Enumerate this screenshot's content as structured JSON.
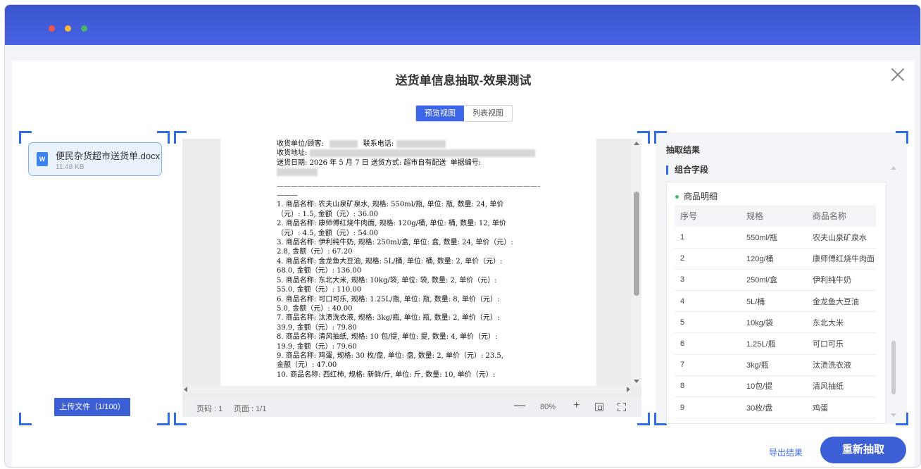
{
  "window": {
    "title": ""
  },
  "modal": {
    "title": "送货单信息抽取-效果测试"
  },
  "view_tabs": {
    "preview": "预览视图",
    "list": "列表视图",
    "active": "preview"
  },
  "file": {
    "name": "便民杂货超市送货单.docx",
    "size": "11.48 KB",
    "icon_letter": "W"
  },
  "upload_button": "上传文件（1/100）",
  "document": {
    "header_lines": [
      {
        "prefix": "收货单位/顾客:",
        "suffix": "联系电话:"
      },
      {
        "prefix": "收货地址:",
        "suffix": ""
      },
      {
        "prefix": "送货日期: 2026 年 5 月 7 日 送货方式: 超市自有配送  单据编号:",
        "suffix": ""
      }
    ],
    "divider": "————————————————————————————————————————",
    "divider_tail": "———",
    "lines": [
      "1. 商品名称: 农夫山泉矿泉水, 规格: 550ml/瓶, 单位: 瓶, 数量: 24, 单价",
      "（元）: 1.5, 金额（元）: 36.00",
      "2. 商品名称: 康师傅红烧牛肉面, 规格: 120g/桶, 单位: 桶, 数量: 12, 单价",
      "（元）: 4.5, 金额（元）: 54.00",
      "3. 商品名称: 伊利纯牛奶, 规格: 250ml/盒, 单位: 盒, 数量: 24, 单价（元）:",
      "2.8, 金额（元）: 67.20",
      "4. 商品名称: 金龙鱼大豆油, 规格: 5L/桶, 单位: 桶, 数量: 2, 单价（元）:",
      "68.0, 金额（元）: 136.00",
      "5. 商品名称: 东北大米, 规格: 10kg/袋, 单位: 袋, 数量: 2, 单价（元）:",
      "55.0, 金额（元）: 110.00",
      "6. 商品名称: 可口可乐, 规格: 1.25L/瓶, 单位: 瓶, 数量: 8, 单价（元）:",
      "5.0, 金额（元）: 40.00",
      "7. 商品名称: 汰渍洗衣液, 规格: 3kg/瓶, 单位: 瓶, 数量: 2, 单价（元）:",
      "39.9, 金额（元）: 79.80",
      "8. 商品名称: 清风抽纸, 规格: 10 包/提, 单位: 提, 数量: 4, 单价（元）:",
      "19.9, 金额（元）: 79.60",
      "9. 商品名称: 鸡蛋, 规格: 30 枚/盘, 单位: 盘, 数量: 2, 单价（元）: 23.5,",
      "金额（元）: 47.00",
      "10. 商品名称: 西红柿, 规格: 新鲜/斤, 单位: 斤, 数量: 10, 单价（元）:"
    ]
  },
  "doc_toolbar": {
    "page_no": "页码 : 1",
    "pages": "页面 : 1/1",
    "minus": "—",
    "zoom": "80%",
    "plus": "+"
  },
  "result": {
    "title": "抽取结果",
    "group": "组合字段",
    "detail_title": "商品明细",
    "columns": [
      "序号",
      "规格",
      "商品名称"
    ],
    "rows": [
      [
        "1",
        "550ml/瓶",
        "农夫山泉矿泉水"
      ],
      [
        "2",
        "120g/桶",
        "康师傅红烧牛肉面"
      ],
      [
        "3",
        "250ml/盒",
        "伊利纯牛奶"
      ],
      [
        "4",
        "5L/桶",
        "金龙鱼大豆油"
      ],
      [
        "5",
        "10kg/袋",
        "东北大米"
      ],
      [
        "6",
        "1.25L/瓶",
        "可口可乐"
      ],
      [
        "7",
        "3kg/瓶",
        "汰渍洗衣液"
      ],
      [
        "8",
        "10包/提",
        "清风抽纸"
      ],
      [
        "9",
        "30枚/盘",
        "鸡蛋"
      ]
    ]
  },
  "footer": {
    "export": "导出结果",
    "reextract": "重新抽取"
  },
  "colors": {
    "accent": "#3d5fd6",
    "titlebar": "#4763e3",
    "corner": "#2f6ee8"
  }
}
